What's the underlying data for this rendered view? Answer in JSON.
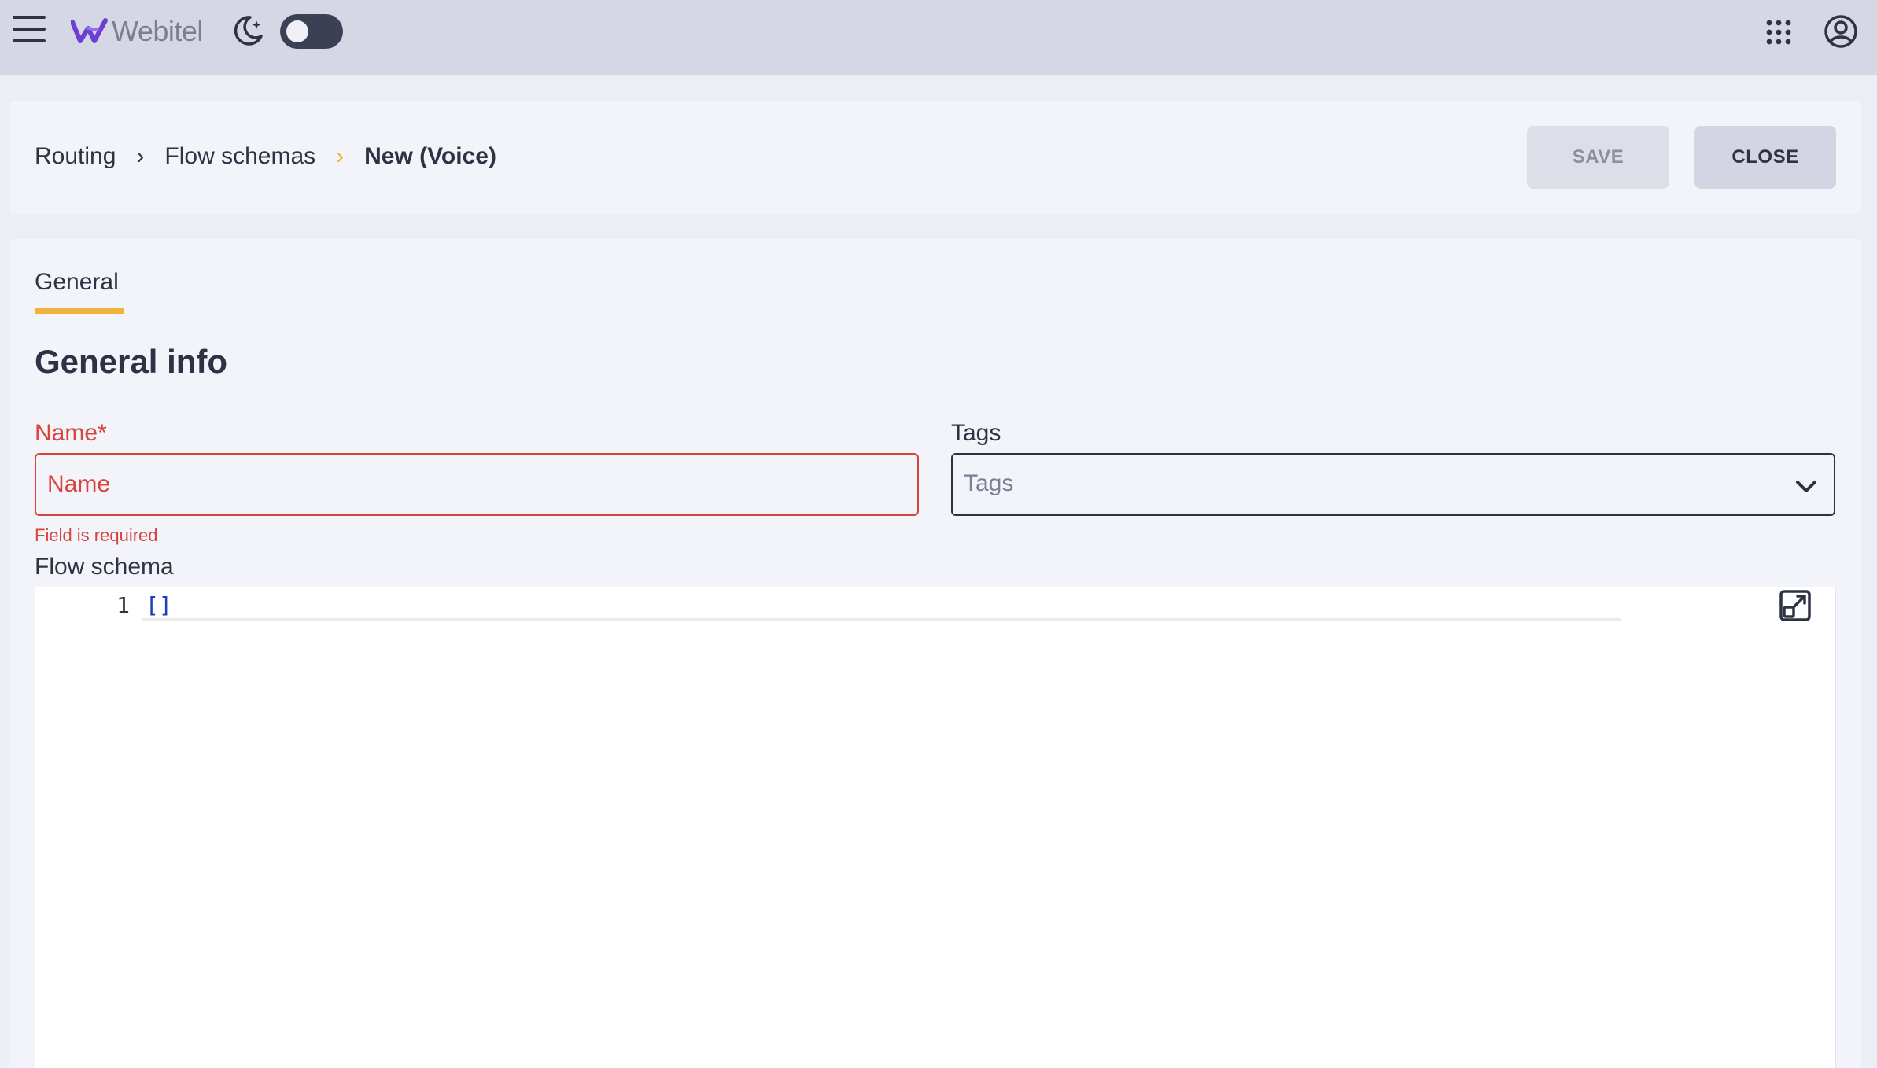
{
  "topbar": {
    "logo_text": "Webitel",
    "icons": [
      "menu-icon",
      "moon-icon",
      "apps-icon",
      "account-icon"
    ],
    "theme_toggle": "off"
  },
  "header": {
    "breadcrumbs": [
      "Routing",
      "Flow schemas",
      "New (Voice)"
    ],
    "save_label": "SAVE",
    "close_label": "CLOSE"
  },
  "main": {
    "tabs": [
      {
        "label": "General",
        "active": true
      }
    ],
    "section_title": "General info",
    "name_field": {
      "label": "Name*",
      "placeholder": "Name",
      "value": "",
      "error": "Field is required"
    },
    "tags_field": {
      "label": "Tags",
      "placeholder": "Tags"
    },
    "flow_schema": {
      "label": "Flow schema",
      "line_number": "1",
      "code": "[]"
    }
  },
  "colors": {
    "accent": "#f0b23b",
    "error": "#d9443d",
    "text": "#2d3345",
    "topbar": "#d5d8e4",
    "brand": "#6b3fd4"
  }
}
